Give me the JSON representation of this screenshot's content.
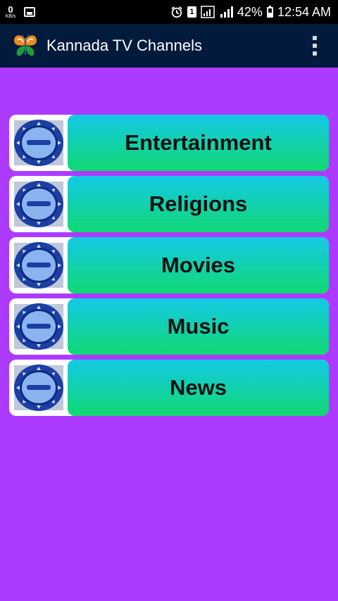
{
  "status_bar": {
    "net_speed_value": "0",
    "net_speed_unit": "KB/s",
    "sim_label": "1",
    "battery": "42%",
    "time": "12:54 AM"
  },
  "app_bar": {
    "title": "Kannada TV Channels"
  },
  "categories": [
    {
      "label": "Entertainment"
    },
    {
      "label": "Religions"
    },
    {
      "label": "Movies"
    },
    {
      "label": "Music"
    },
    {
      "label": "News"
    }
  ],
  "colors": {
    "background": "#ad3bff",
    "app_bar": "#021a3c",
    "button_top": "#14c9e6",
    "button_bottom": "#10d970"
  }
}
